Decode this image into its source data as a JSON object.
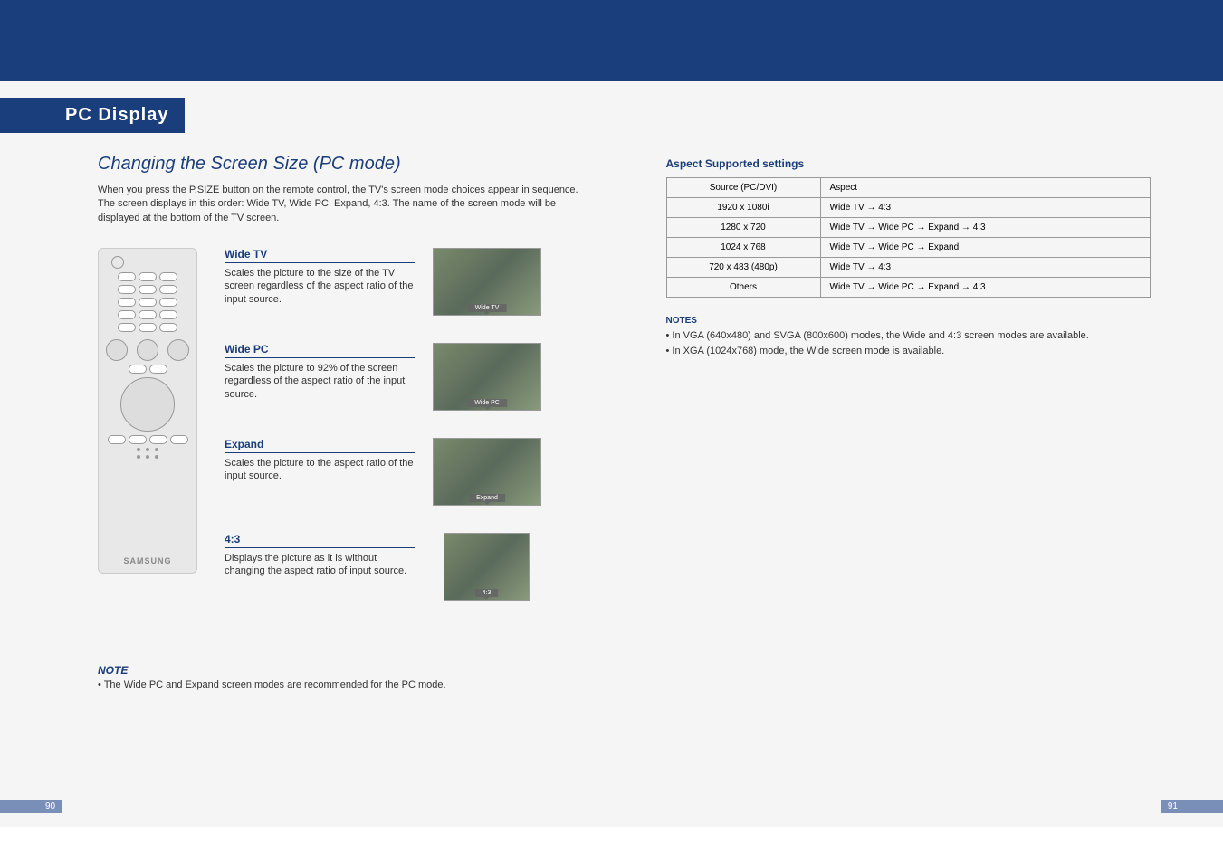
{
  "section_tab": "PC Display",
  "subtitle": "Changing the Screen Size (PC mode)",
  "intro": "When you press the P.SIZE button on the remote control, the TV's screen mode choices appear in sequence. The screen displays in this order: Wide TV, Wide PC, Expand, 4:3. The name of the screen mode will be displayed at the bottom of the TV screen.",
  "remote_brand": "SAMSUNG",
  "modes": {
    "wide_tv": {
      "title": "Wide TV",
      "desc": "Scales the picture to the size of the TV screen regardless of the aspect ratio of the input source.",
      "thumb_label": "Wide TV"
    },
    "wide_pc": {
      "title": "Wide PC",
      "desc": "Scales the picture to 92% of the screen regardless of the aspect ratio of the input source.",
      "thumb_label": "Wide PC"
    },
    "expand": {
      "title": "Expand",
      "desc": "Scales the picture to the aspect ratio of the input source.",
      "thumb_label": "Expand"
    },
    "four_three": {
      "title": "4:3",
      "desc": "Displays the picture as it is without changing the aspect ratio of input source.",
      "thumb_label": "4:3"
    }
  },
  "note_label": "NOTE",
  "note_text": "• The Wide PC and Expand screen modes are recommended for the PC mode.",
  "right": {
    "heading": "Aspect Supported settings",
    "table": {
      "headers": [
        "Source (PC/DVI)",
        "Aspect"
      ],
      "rows": [
        [
          "1920 x 1080i",
          "Wide TV → 4:3"
        ],
        [
          "1280 x 720",
          "Wide TV → Wide PC → Expand → 4:3"
        ],
        [
          "1024 x 768",
          "Wide TV → Wide PC → Expand"
        ],
        [
          "720 x 483 (480p)",
          "Wide TV → 4:3"
        ],
        [
          "Others",
          "Wide TV → Wide PC → Expand → 4:3"
        ]
      ]
    },
    "notes_heading": "NOTES",
    "notes": [
      "• In VGA (640x480) and SVGA (800x600) modes, the Wide and 4:3 screen modes are available.",
      "• In XGA (1024x768) mode, the Wide screen mode is available."
    ]
  },
  "page_left": "90",
  "page_right": "91"
}
